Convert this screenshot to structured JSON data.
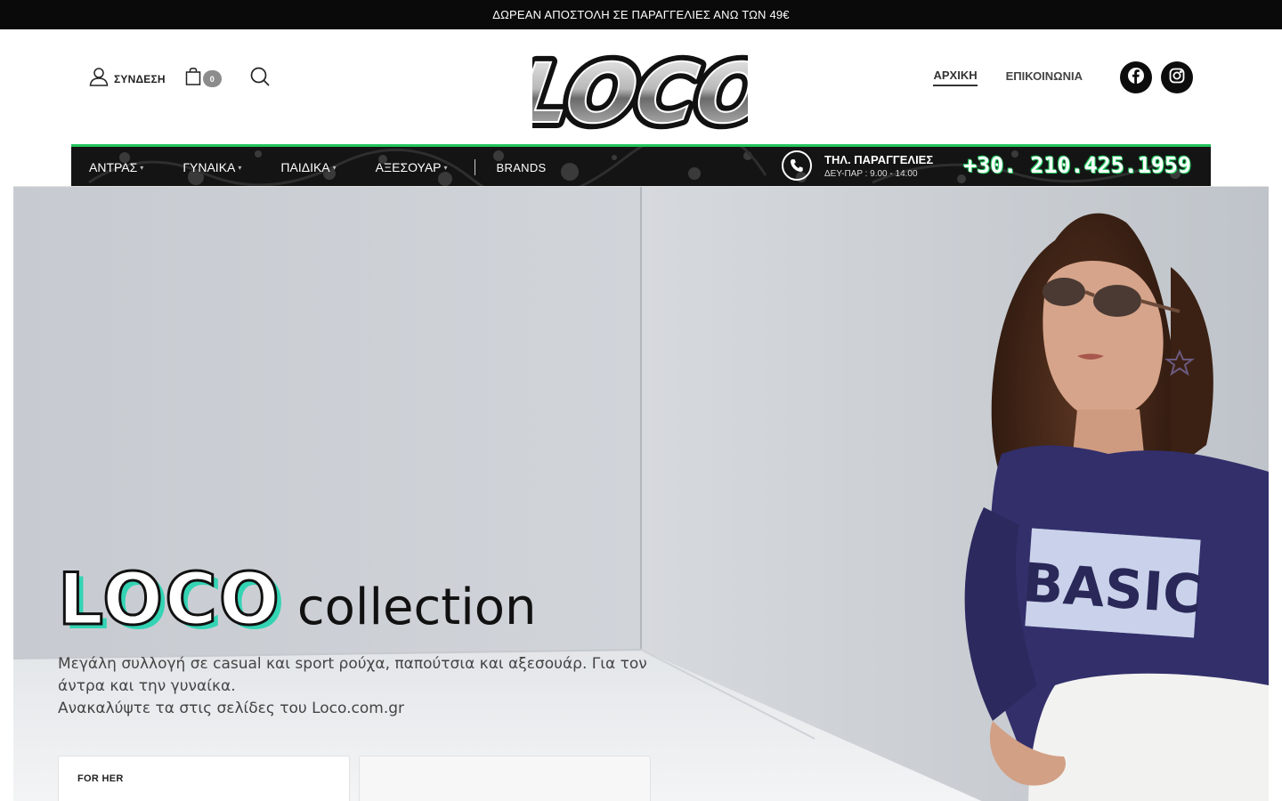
{
  "promo": {
    "text": "ΔΩΡΕΑΝ ΑΠΟΣΤΟΛΗ ΣΕ ΠΑΡΑΓΓΕΛΙΕΣ ΑΝΩ ΤΩΝ 49€"
  },
  "header": {
    "login_label": "ΣΥΝΔΕΣΗ",
    "cart_count": "0",
    "logo_text": "LOCO",
    "nav": [
      {
        "label": "ΑΡΧΙΚΗ",
        "active": true
      },
      {
        "label": "ΕΠΙΚΟΙΝΩΝΙΑ",
        "active": false
      }
    ],
    "social": [
      "facebook-icon",
      "instagram-icon"
    ]
  },
  "categories": [
    {
      "label": "ΑΝΤΡΑΣ",
      "dropdown": true
    },
    {
      "label": "ΓΥΝΑΙΚΑ",
      "dropdown": true
    },
    {
      "label": "ΠΑΙΔΙΚΑ",
      "dropdown": true
    },
    {
      "label": "ΑΞΕΣΟΥΑΡ",
      "dropdown": true
    },
    {
      "label": "BRANDS",
      "dropdown": false
    }
  ],
  "phone": {
    "title": "ΤΗΛ. ΠΑΡΑΓΓΕΛΙΕΣ",
    "hours": "ΔΕΥ-ΠΑΡ : 9.00 - 14.00",
    "number": "+30. 210.425.1959"
  },
  "hero": {
    "title_brand": "LOCO",
    "title_rest": "collection",
    "desc_line1": "Μεγάλη συλλογή σε casual και sport ρούχα, παπούτσια και αξεσουάρ. Για τον άντρα και την γυναίκα.",
    "desc_line2": "Ανακαλύψτε τα στις σελίδες του Loco.com.gr",
    "shirt_text": "BASIC",
    "cards": [
      {
        "label": "FOR HER"
      },
      {
        "label": ""
      }
    ]
  },
  "colors": {
    "accent_green": "#22c55e",
    "accent_teal": "#33d4b4",
    "dark": "#0a0a0a",
    "badge": "#8c8c8c"
  }
}
